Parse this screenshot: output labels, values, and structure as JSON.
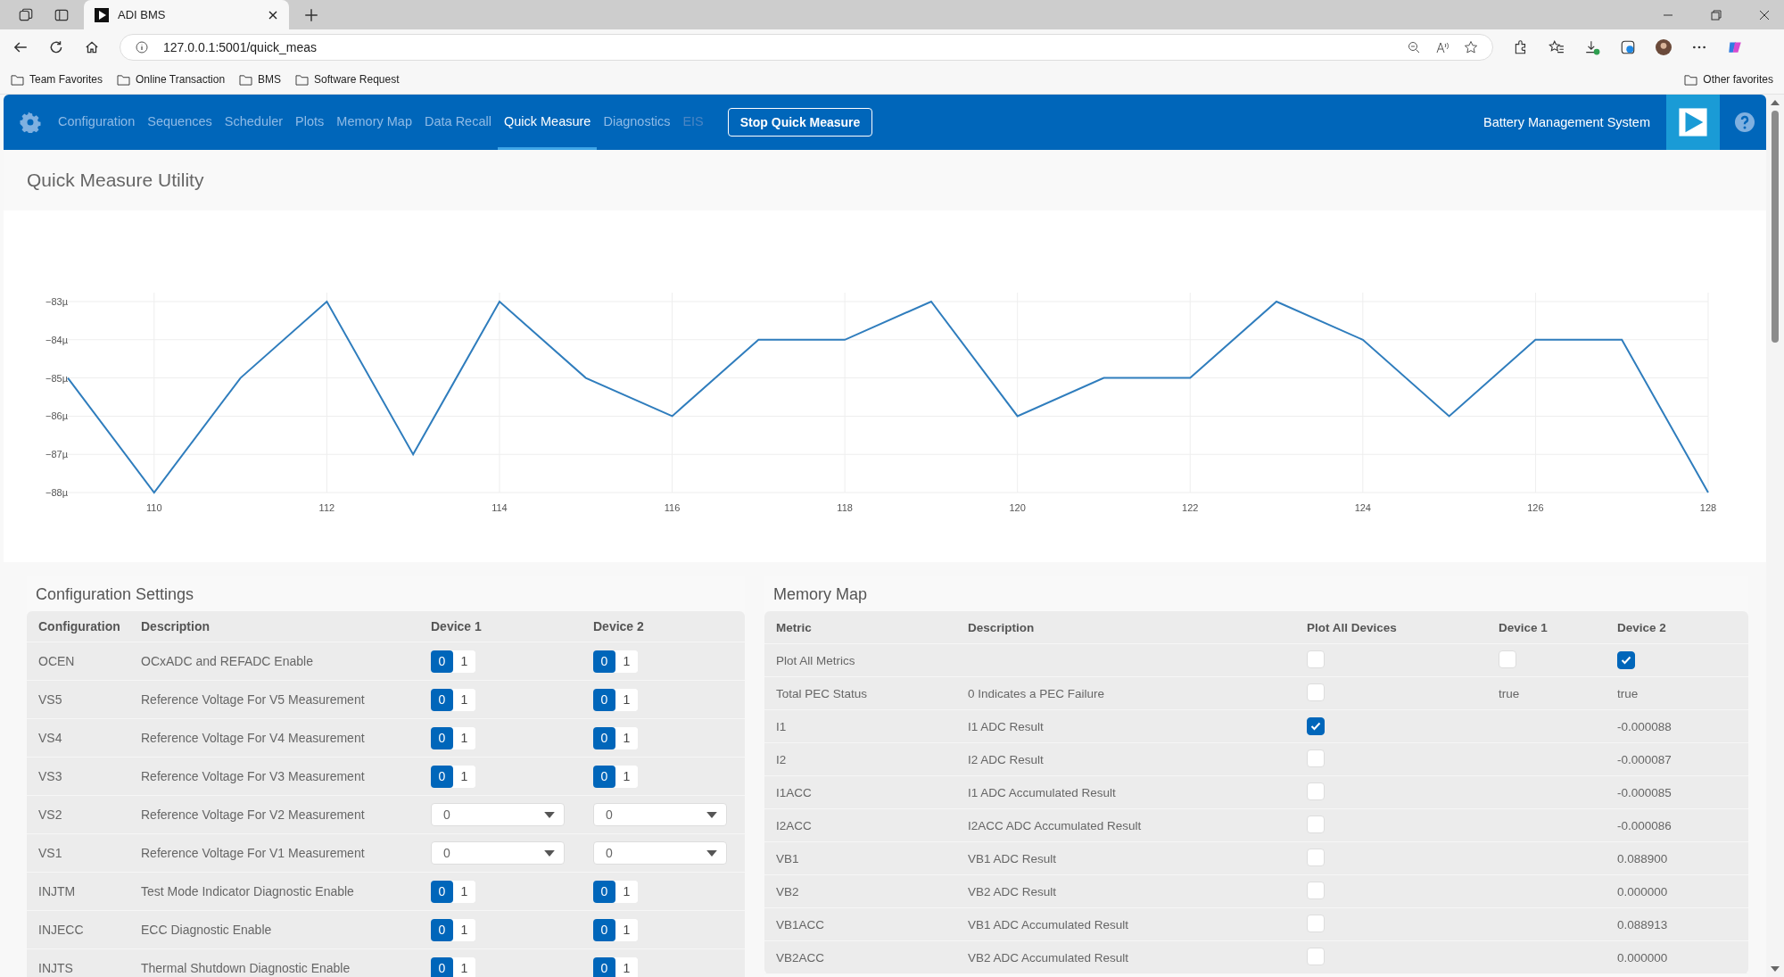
{
  "browser": {
    "tab_title": "ADI BMS",
    "address": "127.0.0.1:5001/quick_meas",
    "bookmarks": [
      "Team Favorites",
      "Online Transaction",
      "BMS",
      "Software Request"
    ],
    "other_favorites": "Other favorites"
  },
  "nav": {
    "items": [
      {
        "label": "Configuration",
        "selected": false,
        "disabled": false
      },
      {
        "label": "Sequences",
        "selected": false,
        "disabled": false
      },
      {
        "label": "Scheduler",
        "selected": false,
        "disabled": false
      },
      {
        "label": "Plots",
        "selected": false,
        "disabled": false
      },
      {
        "label": "Memory Map",
        "selected": false,
        "disabled": false
      },
      {
        "label": "Data Recall",
        "selected": false,
        "disabled": false
      },
      {
        "label": "Quick Measure",
        "selected": true,
        "disabled": false
      },
      {
        "label": "Diagnostics",
        "selected": false,
        "disabled": false
      },
      {
        "label": "EIS",
        "selected": false,
        "disabled": true
      }
    ],
    "action_button": "Stop Quick Measure",
    "app_title": "Battery Management System"
  },
  "page_title": "Quick Measure Utility",
  "chart_data": {
    "type": "line",
    "x": [
      109,
      110,
      111,
      112,
      113,
      114,
      115,
      116,
      117,
      118,
      119,
      120,
      121,
      122,
      123,
      124,
      125,
      126,
      127,
      128
    ],
    "series": [
      {
        "color": "#2f7dbd",
        "values": [
          -85,
          -88,
          -85,
          -83,
          -87,
          -83,
          -85,
          -86,
          -84,
          -84,
          -83,
          -86,
          -85,
          -85,
          -83,
          -84,
          -86,
          -84,
          -84,
          -88
        ]
      }
    ],
    "grid": true,
    "xlim": [
      109,
      128
    ],
    "ylim": [
      -88,
      -83
    ],
    "xticks": [
      110,
      112,
      114,
      116,
      118,
      120,
      122,
      124,
      126,
      128
    ],
    "yticks": [
      {
        "value": -83,
        "label": "−83µ"
      },
      {
        "value": -84,
        "label": "−84µ"
      },
      {
        "value": -85,
        "label": "−85µ"
      },
      {
        "value": -86,
        "label": "−86µ"
      },
      {
        "value": -87,
        "label": "−87µ"
      },
      {
        "value": -88,
        "label": "−88µ"
      }
    ]
  },
  "config": {
    "title": "Configuration Settings",
    "columns": [
      "Configuration",
      "Description",
      "Device 1",
      "Device 2"
    ],
    "rows": [
      {
        "name": "OCEN",
        "description": "OCxADC and REFADC Enable",
        "devices": [
          {
            "kind": "toggle",
            "options": [
              {
                "label": "0",
                "selected": true
              },
              {
                "label": "1",
                "selected": false
              }
            ]
          },
          {
            "kind": "toggle",
            "options": [
              {
                "label": "0",
                "selected": true
              },
              {
                "label": "1",
                "selected": false
              }
            ]
          }
        ]
      },
      {
        "name": "VS5",
        "description": "Reference Voltage For V5 Measurement",
        "devices": [
          {
            "kind": "toggle",
            "options": [
              {
                "label": "0",
                "selected": true
              },
              {
                "label": "1",
                "selected": false
              }
            ]
          },
          {
            "kind": "toggle",
            "options": [
              {
                "label": "0",
                "selected": true
              },
              {
                "label": "1",
                "selected": false
              }
            ]
          }
        ]
      },
      {
        "name": "VS4",
        "description": "Reference Voltage For V4 Measurement",
        "devices": [
          {
            "kind": "toggle",
            "options": [
              {
                "label": "0",
                "selected": true
              },
              {
                "label": "1",
                "selected": false
              }
            ]
          },
          {
            "kind": "toggle",
            "options": [
              {
                "label": "0",
                "selected": true
              },
              {
                "label": "1",
                "selected": false
              }
            ]
          }
        ]
      },
      {
        "name": "VS3",
        "description": "Reference Voltage For V3 Measurement",
        "devices": [
          {
            "kind": "toggle",
            "options": [
              {
                "label": "0",
                "selected": true
              },
              {
                "label": "1",
                "selected": false
              }
            ]
          },
          {
            "kind": "toggle",
            "options": [
              {
                "label": "0",
                "selected": true
              },
              {
                "label": "1",
                "selected": false
              }
            ]
          }
        ]
      },
      {
        "name": "VS2",
        "description": "Reference Voltage For V2 Measurement",
        "devices": [
          {
            "kind": "select",
            "value": "0"
          },
          {
            "kind": "select",
            "value": "0"
          }
        ]
      },
      {
        "name": "VS1",
        "description": "Reference Voltage For V1 Measurement",
        "devices": [
          {
            "kind": "select",
            "value": "0"
          },
          {
            "kind": "select",
            "value": "0"
          }
        ]
      },
      {
        "name": "INJTM",
        "description": "Test Mode Indicator Diagnostic Enable",
        "devices": [
          {
            "kind": "toggle",
            "options": [
              {
                "label": "0",
                "selected": true
              },
              {
                "label": "1",
                "selected": false
              }
            ]
          },
          {
            "kind": "toggle",
            "options": [
              {
                "label": "0",
                "selected": true
              },
              {
                "label": "1",
                "selected": false
              }
            ]
          }
        ]
      },
      {
        "name": "INJECC",
        "description": "ECC Diagnostic Enable",
        "devices": [
          {
            "kind": "toggle",
            "options": [
              {
                "label": "0",
                "selected": true
              },
              {
                "label": "1",
                "selected": false
              }
            ]
          },
          {
            "kind": "toggle",
            "options": [
              {
                "label": "0",
                "selected": true
              },
              {
                "label": "1",
                "selected": false
              }
            ]
          }
        ]
      },
      {
        "name": "INJTS",
        "description": "Thermal Shutdown Diagnostic Enable",
        "devices": [
          {
            "kind": "toggle",
            "options": [
              {
                "label": "0",
                "selected": true
              },
              {
                "label": "1",
                "selected": false
              }
            ]
          },
          {
            "kind": "toggle",
            "options": [
              {
                "label": "0",
                "selected": true
              },
              {
                "label": "1",
                "selected": false
              }
            ]
          }
        ]
      }
    ]
  },
  "memory_map": {
    "title": "Memory Map",
    "columns": [
      "Metric",
      "Description",
      "Plot All Devices",
      "Device 1",
      "Device 2"
    ],
    "rows": [
      {
        "metric": "Plot All Metrics",
        "plot_all": false,
        "device1": {
          "kind": "checkbox",
          "checked": false
        },
        "device2": {
          "kind": "checkbox",
          "checked": true
        }
      },
      {
        "metric": "Total PEC Status",
        "description": "0 Indicates a PEC Failure",
        "plot_all": false,
        "device1": {
          "kind": "text",
          "text": "true"
        },
        "device2": {
          "kind": "text",
          "text": "true"
        }
      },
      {
        "metric": "I1",
        "description": "I1 ADC Result",
        "plot_all": true,
        "device2": {
          "kind": "text",
          "text": "-0.000088"
        }
      },
      {
        "metric": "I2",
        "description": "I2 ADC Result",
        "plot_all": false,
        "device2": {
          "kind": "text",
          "text": "-0.000087"
        }
      },
      {
        "metric": "I1ACC",
        "description": "I1 ADC Accumulated Result",
        "plot_all": false,
        "device2": {
          "kind": "text",
          "text": "-0.000085"
        }
      },
      {
        "metric": "I2ACC",
        "description": "I2ACC ADC Accumulated Result",
        "plot_all": false,
        "device2": {
          "kind": "text",
          "text": "-0.000086"
        }
      },
      {
        "metric": "VB1",
        "description": "VB1 ADC Result",
        "plot_all": false,
        "device2": {
          "kind": "text",
          "text": "0.088900"
        }
      },
      {
        "metric": "VB2",
        "description": "VB2 ADC Result",
        "plot_all": false,
        "device2": {
          "kind": "text",
          "text": "0.000000"
        }
      },
      {
        "metric": "VB1ACC",
        "description": "VB1 ADC Accumulated Result",
        "plot_all": false,
        "device2": {
          "kind": "text",
          "text": "0.088913"
        }
      },
      {
        "metric": "VB2ACC",
        "description": "VB2 ADC Accumulated Result",
        "plot_all": false,
        "device2": {
          "kind": "text",
          "text": "0.000000"
        }
      }
    ]
  }
}
